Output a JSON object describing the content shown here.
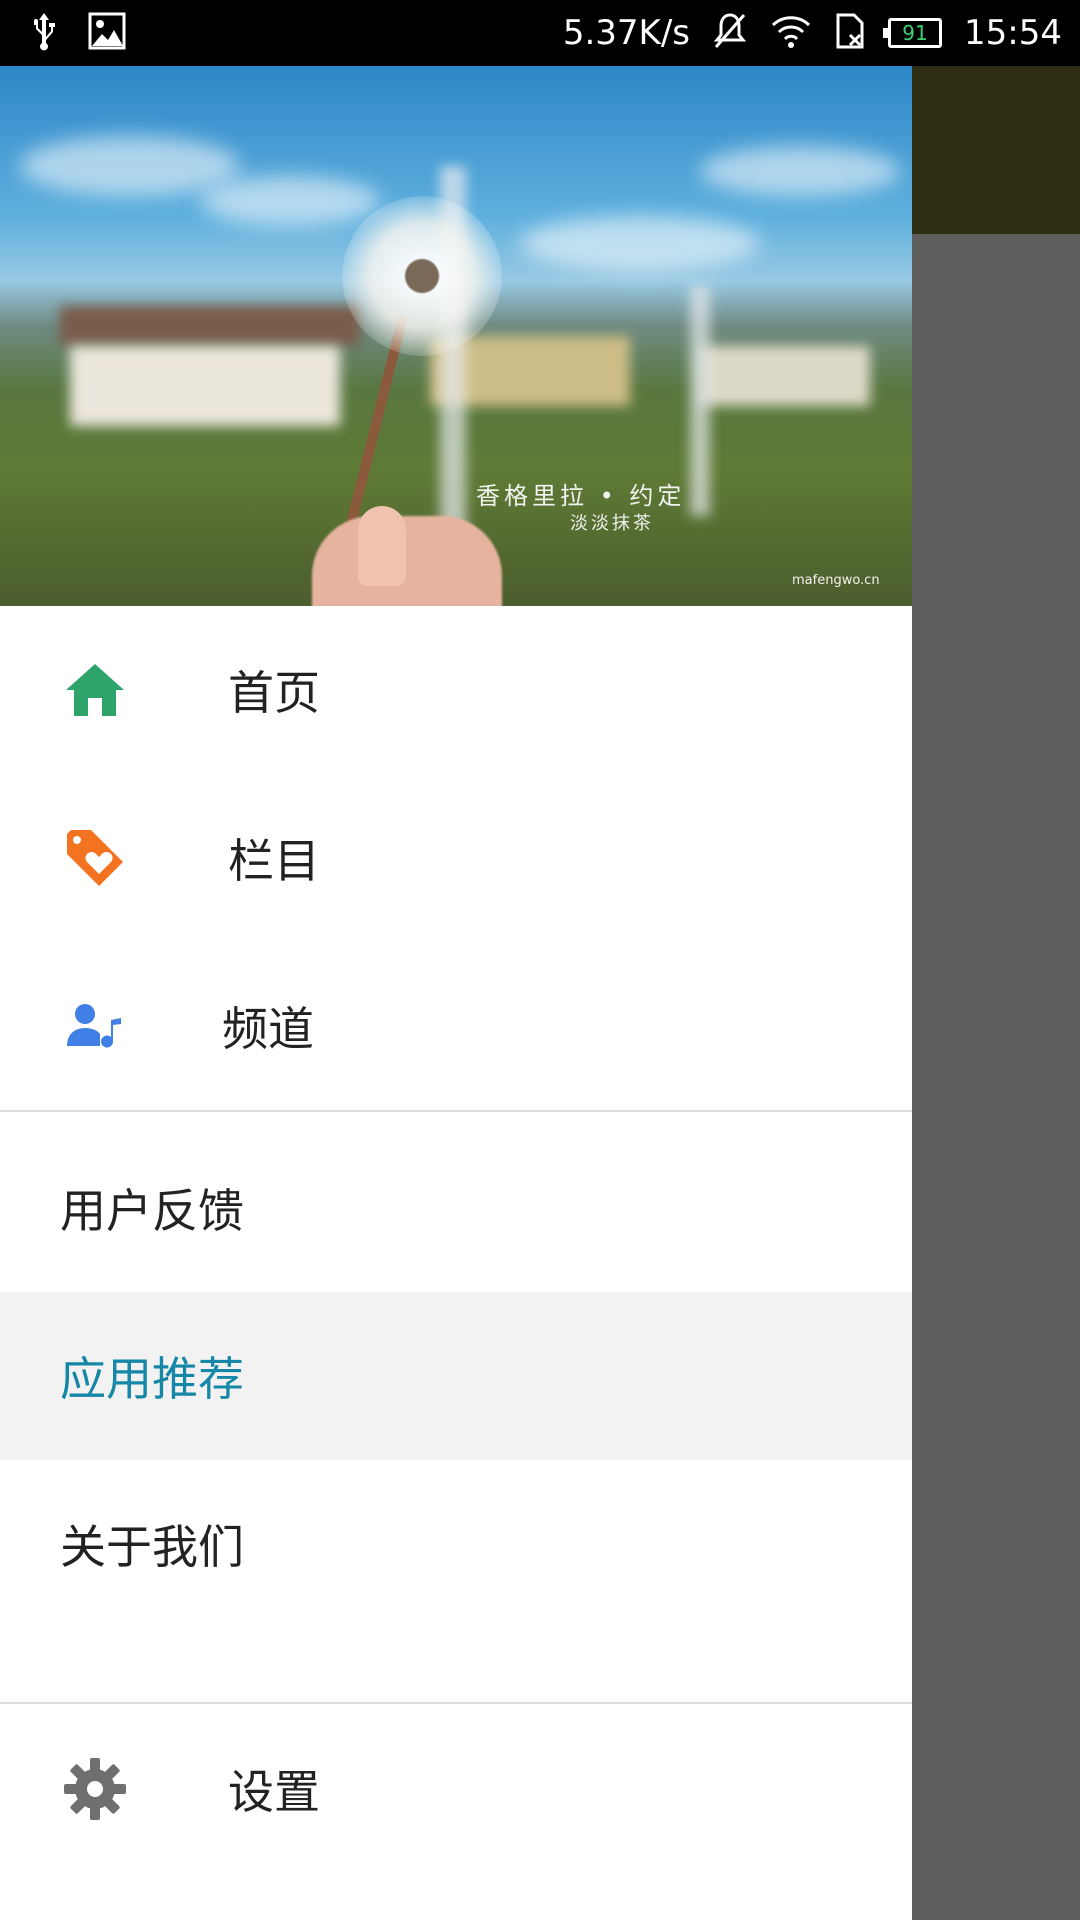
{
  "status_bar": {
    "network_speed": "5.37K/s",
    "battery_level": "91",
    "time": "15:54",
    "left_icons": [
      "usb-icon",
      "image-icon"
    ],
    "right_icons": [
      "mute-icon",
      "wifi-icon",
      "no-sim-icon",
      "battery-icon"
    ]
  },
  "header": {
    "caption": "香格里拉 • 约定",
    "subcaption": "淡淡抹茶",
    "watermark": "mafengwo.cn"
  },
  "menu": {
    "primary": [
      {
        "label": "首页",
        "icon": "home-icon",
        "color": "#2fa46a"
      },
      {
        "label": "栏目",
        "icon": "tag-heart-icon",
        "color": "#f47321"
      },
      {
        "label": "频道",
        "icon": "user-music-icon",
        "color": "#3f7fe6"
      }
    ],
    "secondary": [
      {
        "label": "用户反馈",
        "selected": false
      },
      {
        "label": "应用推荐",
        "selected": true
      },
      {
        "label": "关于我们",
        "selected": false
      }
    ],
    "settings": {
      "label": "设置",
      "icon": "gear-icon",
      "color": "#6f6f6f"
    }
  },
  "colors": {
    "accent": "#1687a7",
    "selected_bg": "#f2f2f2",
    "scrim": "#5f5f5f"
  }
}
